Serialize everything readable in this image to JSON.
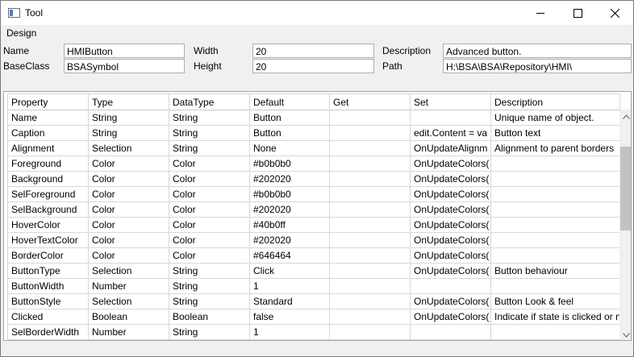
{
  "window": {
    "title": "Tool"
  },
  "icons": {
    "app": "window-app-icon",
    "minimize": "minimize-icon",
    "maximize": "maximize-icon",
    "close": "close-icon",
    "scroll_up": "chevron-up-icon",
    "scroll_down": "chevron-down-icon"
  },
  "menu": {
    "items": [
      "Design"
    ]
  },
  "properties": {
    "name_label": "Name",
    "name_value": "HMIButton",
    "baseclass_label": "BaseClass",
    "baseclass_value": "BSASymbol",
    "width_label": "Width",
    "width_value": "20",
    "height_label": "Height",
    "height_value": "20",
    "description_label": "Description",
    "description_value": "Advanced button.",
    "path_label": "Path",
    "path_value": "H:\\BSA\\BSA\\Repository\\HMI\\"
  },
  "grid": {
    "columns": [
      "Property",
      "Type",
      "DataType",
      "Default",
      "Get",
      "Set",
      "Description"
    ],
    "rows": [
      [
        "Name",
        "String",
        "String",
        "Button",
        "",
        "",
        "Unique name of object."
      ],
      [
        "Caption",
        "String",
        "String",
        "Button",
        "",
        "edit.Content = va",
        "Button text"
      ],
      [
        "Alignment",
        "Selection",
        "String",
        "None",
        "",
        "OnUpdateAlignm",
        "Alignment to parent borders"
      ],
      [
        "Foreground",
        "Color",
        "Color",
        "#b0b0b0",
        "",
        "OnUpdateColors(",
        ""
      ],
      [
        "Background",
        "Color",
        "Color",
        "#202020",
        "",
        "OnUpdateColors(",
        ""
      ],
      [
        "SelForeground",
        "Color",
        "Color",
        "#b0b0b0",
        "",
        "OnUpdateColors(",
        ""
      ],
      [
        "SelBackground",
        "Color",
        "Color",
        "#202020",
        "",
        "OnUpdateColors(",
        ""
      ],
      [
        "HoverColor",
        "Color",
        "Color",
        "#40b0ff",
        "",
        "OnUpdateColors(",
        ""
      ],
      [
        "HoverTextColor",
        "Color",
        "Color",
        "#202020",
        "",
        "OnUpdateColors(",
        ""
      ],
      [
        "BorderColor",
        "Color",
        "Color",
        "#646464",
        "",
        "OnUpdateColors(",
        ""
      ],
      [
        "ButtonType",
        "Selection",
        "String",
        "Click",
        "",
        "OnUpdateColors(",
        "Button behaviour"
      ],
      [
        "ButtonWidth",
        "Number",
        "String",
        "1",
        "",
        "",
        ""
      ],
      [
        "ButtonStyle",
        "Selection",
        "String",
        "Standard",
        "",
        "OnUpdateColors(",
        "Button Look & feel"
      ],
      [
        "Clicked",
        "Boolean",
        "Boolean",
        "false",
        "",
        "OnUpdateColors(",
        "Indicate if state is clicked or n"
      ],
      [
        "SelBorderWidth",
        "Number",
        "String",
        "1",
        "",
        "",
        ""
      ]
    ]
  },
  "colors": {
    "grid_line": "#d8d8d8",
    "frame_border": "#9aa7b7",
    "accent": "#4a7cc0"
  }
}
